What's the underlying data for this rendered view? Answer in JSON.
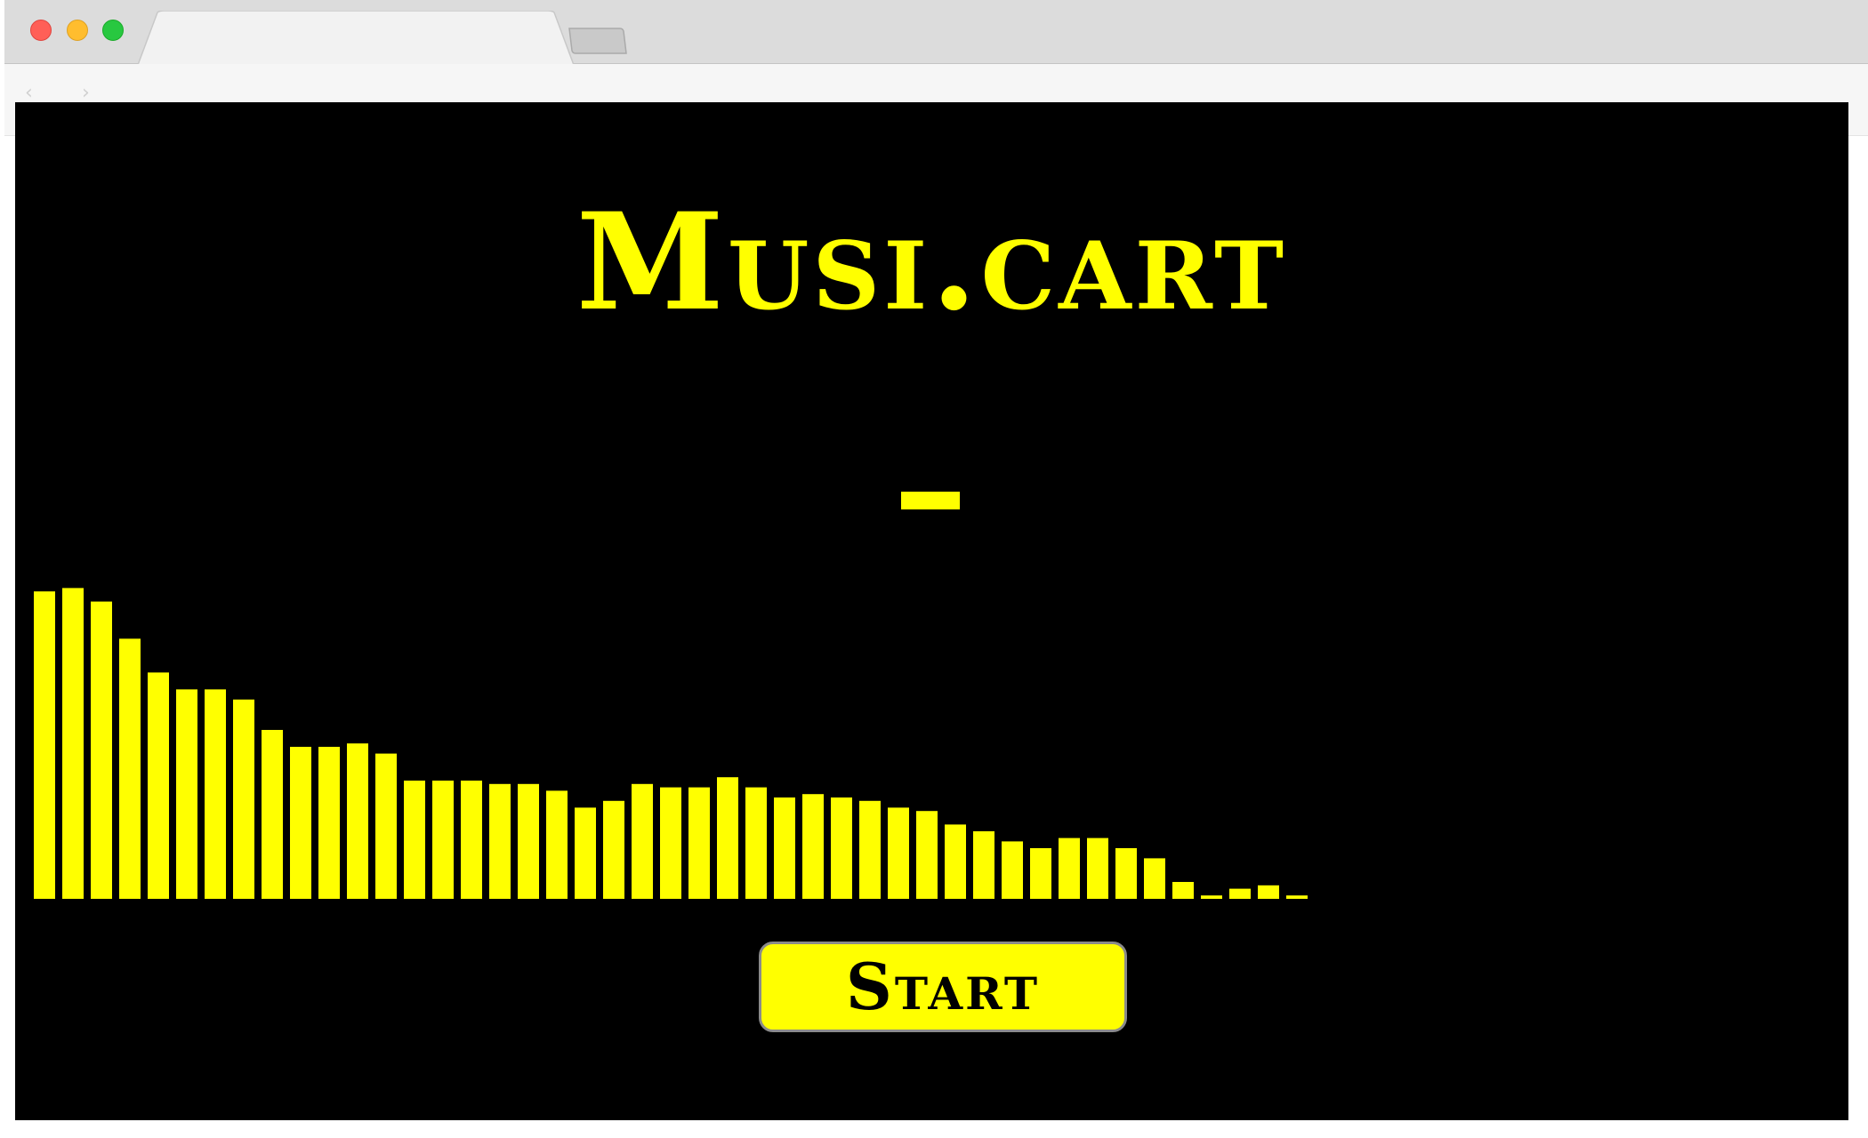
{
  "app": {
    "title": "Musi.cart",
    "status": "",
    "start_label": "Start",
    "accent_color": "#ffff00",
    "background_color": "#000000"
  },
  "browser": {
    "tab_title": "",
    "traffic_lights": [
      "close-icon",
      "minimize-icon",
      "maximize-icon"
    ]
  },
  "visualizer": {
    "type": "frequency-bars",
    "bar_count": 45,
    "values": [
      0.91,
      0.92,
      0.88,
      0.77,
      0.67,
      0.62,
      0.62,
      0.59,
      0.5,
      0.45,
      0.45,
      0.46,
      0.43,
      0.35,
      0.35,
      0.35,
      0.34,
      0.34,
      0.32,
      0.27,
      0.29,
      0.34,
      0.33,
      0.33,
      0.36,
      0.33,
      0.3,
      0.31,
      0.3,
      0.29,
      0.27,
      0.26,
      0.22,
      0.2,
      0.17,
      0.15,
      0.18,
      0.18,
      0.15,
      0.12,
      0.05,
      0.01,
      0.03,
      0.04,
      0.01
    ]
  }
}
